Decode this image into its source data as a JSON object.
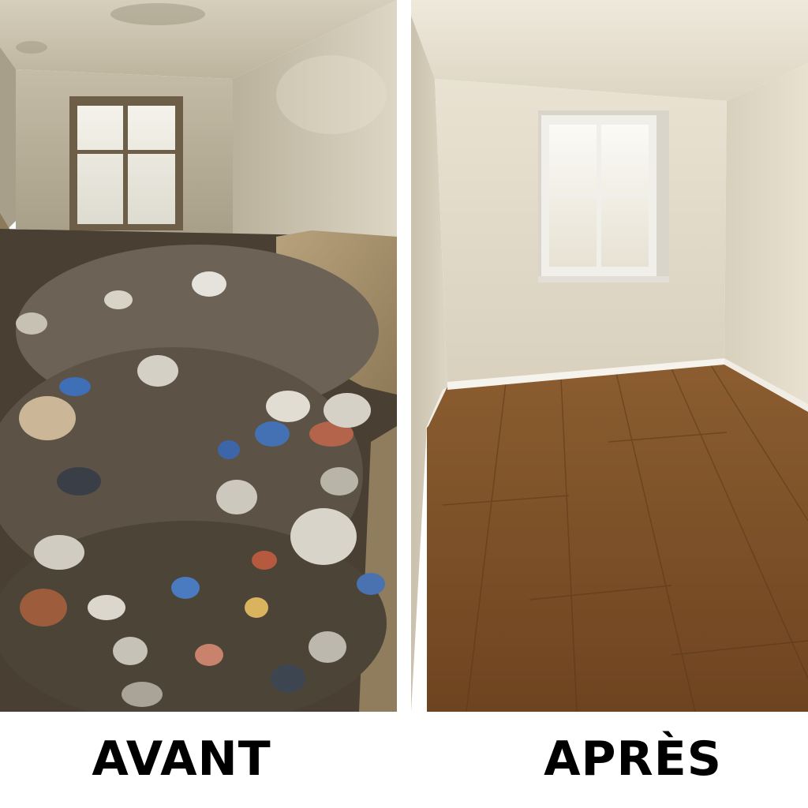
{
  "captions": {
    "before": "AVANT",
    "after": "APRÈS"
  },
  "colors": {
    "background": "#ffffff",
    "caption_text": "#000000",
    "before_wall": "#cbc4b0",
    "before_ceiling": "#c9c1ad",
    "after_wall": "#e3dccb",
    "after_floor": "#7a4e26"
  }
}
